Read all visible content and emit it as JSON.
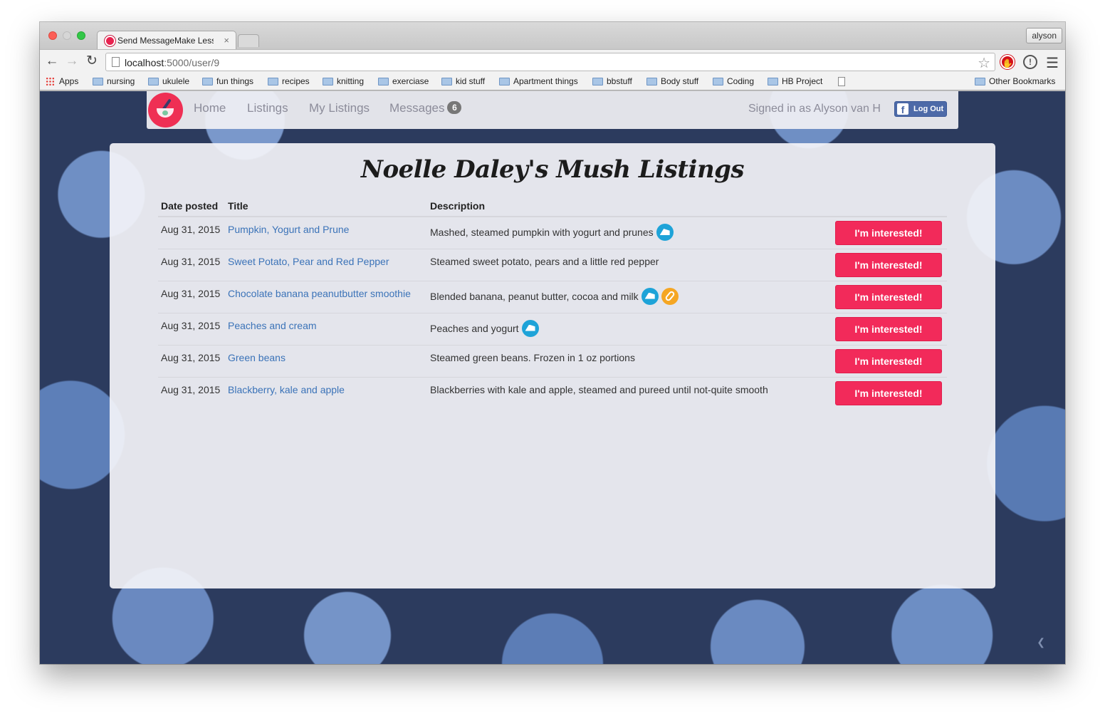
{
  "browser": {
    "tab_title": "Send MessageMake Less M",
    "tab_close": "×",
    "profile": "alyson",
    "url_host": "localhost",
    "url_path": ":5000/user/9",
    "bookmarks": [
      {
        "label": "Apps",
        "icon": "apps-grid-icon"
      },
      {
        "label": "nursing",
        "icon": "folder-icon"
      },
      {
        "label": "ukulele",
        "icon": "folder-icon"
      },
      {
        "label": "fun things",
        "icon": "folder-icon"
      },
      {
        "label": "recipes",
        "icon": "folder-icon"
      },
      {
        "label": "knitting",
        "icon": "folder-icon"
      },
      {
        "label": "exerciase",
        "icon": "folder-icon"
      },
      {
        "label": "kid stuff",
        "icon": "folder-icon"
      },
      {
        "label": "Apartment things",
        "icon": "folder-icon"
      },
      {
        "label": "bbstuff",
        "icon": "folder-icon"
      },
      {
        "label": "Body stuff",
        "icon": "folder-icon"
      },
      {
        "label": "Coding",
        "icon": "folder-icon"
      },
      {
        "label": "HB Project",
        "icon": "folder-icon"
      }
    ],
    "other_bookmarks": "Other Bookmarks"
  },
  "site": {
    "nav": {
      "home": "Home",
      "listings": "Listings",
      "my_listings": "My Listings",
      "messages": "Messages",
      "messages_count": "6",
      "signed_in": "Signed in as Alyson van H",
      "logout": "Log Out"
    },
    "colors": {
      "accent": "#f22a5a",
      "link": "#3b73b8",
      "facebook": "#4d6aa8",
      "dairy_badge": "#1ea3d8",
      "nut_badge": "#f5a623"
    },
    "page_title": "Noelle Daley's Mush Listings",
    "table": {
      "headers": {
        "date": "Date posted",
        "title": "Title",
        "description": "Description"
      },
      "button_label": "I'm interested!",
      "rows": [
        {
          "date": "Aug 31, 2015",
          "title": "Pumpkin, Yogurt and Prune",
          "description": "Mashed, steamed pumpkin with yogurt and prunes",
          "allergens": [
            "dairy-icon"
          ]
        },
        {
          "date": "Aug 31, 2015",
          "title": "Sweet Potato, Pear and Red Pepper",
          "description": "Steamed sweet potato, pears and a little red pepper",
          "allergens": []
        },
        {
          "date": "Aug 31, 2015",
          "title": "Chocolate banana peanutbutter smoothie",
          "description": "Blended banana, peanut butter, cocoa and milk",
          "allergens": [
            "dairy-icon",
            "peanut-icon"
          ]
        },
        {
          "date": "Aug 31, 2015",
          "title": "Peaches and cream",
          "description": "Peaches and yogurt",
          "allergens": [
            "dairy-icon"
          ]
        },
        {
          "date": "Aug 31, 2015",
          "title": "Green beans",
          "description": "Steamed green beans. Frozen in 1 oz portions",
          "allergens": []
        },
        {
          "date": "Aug 31, 2015",
          "title": "Blackberry, kale and apple",
          "description": "Blackberries with kale and apple, steamed and pureed until not-quite smooth",
          "allergens": []
        }
      ]
    }
  }
}
